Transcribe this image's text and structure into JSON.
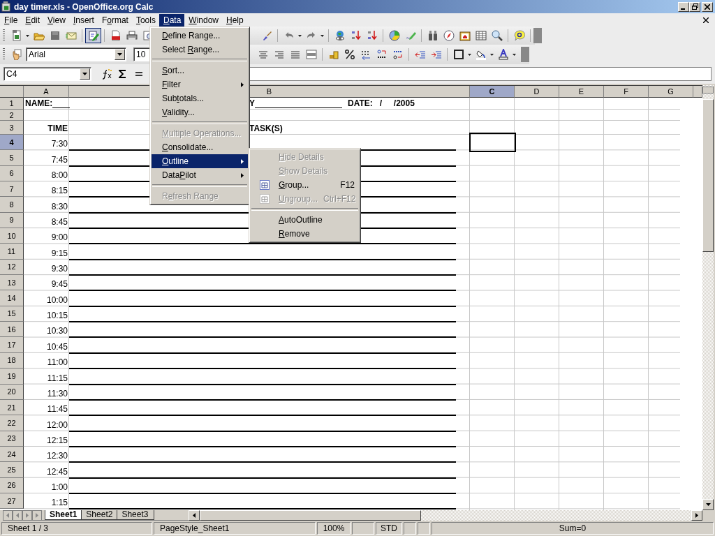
{
  "window": {
    "title": "day timer.xls - OpenOffice.org Calc"
  },
  "menu_bar": [
    {
      "key": "F",
      "post": "ile",
      "selected": false
    },
    {
      "key": "E",
      "post": "dit",
      "selected": false
    },
    {
      "key": "V",
      "post": "iew",
      "selected": false
    },
    {
      "key": "I",
      "post": "nsert",
      "selected": false
    },
    {
      "pre": "F",
      "key": "o",
      "post": "rmat",
      "selected": false
    },
    {
      "key": "T",
      "post": "ools",
      "selected": false
    },
    {
      "key": "D",
      "post": "ata",
      "selected": true
    },
    {
      "key": "W",
      "post": "indow",
      "selected": false
    },
    {
      "key": "H",
      "post": "elp",
      "selected": false
    }
  ],
  "data_menu": [
    {
      "kind": "item",
      "key": "D",
      "post": "efine Range...",
      "disabled": false,
      "selected": false,
      "submenu": false
    },
    {
      "kind": "item",
      "pre": "Select ",
      "key": "R",
      "post": "ange...",
      "disabled": false,
      "selected": false,
      "submenu": false
    },
    {
      "kind": "separator"
    },
    {
      "kind": "item",
      "key": "S",
      "post": "ort...",
      "disabled": false,
      "selected": false,
      "submenu": false
    },
    {
      "kind": "item",
      "key": "F",
      "post": "ilter",
      "disabled": false,
      "selected": false,
      "submenu": true
    },
    {
      "kind": "item",
      "pre": "Sub",
      "key": "t",
      "post": "otals...",
      "disabled": false,
      "selected": false,
      "submenu": false
    },
    {
      "kind": "item",
      "key": "V",
      "post": "alidity...",
      "disabled": false,
      "selected": false,
      "submenu": false
    },
    {
      "kind": "separator"
    },
    {
      "kind": "item",
      "key": "M",
      "post": "ultiple Operations...",
      "disabled": true,
      "selected": false,
      "submenu": false
    },
    {
      "kind": "item",
      "key": "C",
      "post": "onsolidate...",
      "disabled": false,
      "selected": false,
      "submenu": false
    },
    {
      "kind": "item",
      "key": "O",
      "post": "utline",
      "disabled": false,
      "selected": true,
      "submenu": true
    },
    {
      "kind": "item",
      "pre": "Data",
      "key": "P",
      "post": "ilot",
      "disabled": false,
      "selected": false,
      "submenu": true
    },
    {
      "kind": "separator"
    },
    {
      "kind": "item",
      "pre": "R",
      "key": "e",
      "post": "fresh Range",
      "disabled": true,
      "selected": false,
      "submenu": false
    }
  ],
  "outline_submenu": [
    {
      "kind": "item",
      "key": "H",
      "post": "ide Details",
      "disabled": true
    },
    {
      "kind": "item",
      "key": "S",
      "post": "how Details",
      "disabled": true
    },
    {
      "kind": "icon-item",
      "key": "G",
      "post": "roup...",
      "shortcut": "F12",
      "disabled": false
    },
    {
      "kind": "icon-item",
      "key": "U",
      "post": "ngroup...",
      "shortcut": "Ctrl+F12",
      "disabled": true
    },
    {
      "kind": "separator"
    },
    {
      "kind": "item",
      "key": "A",
      "post": "utoOutline",
      "disabled": false
    },
    {
      "kind": "item",
      "key": "R",
      "post": "emove",
      "disabled": false
    }
  ],
  "font": {
    "name": "Arial",
    "size": "10"
  },
  "name_box": "C4",
  "columns": [
    {
      "label": "A",
      "selected": false
    },
    {
      "label": "B",
      "selected": false
    },
    {
      "label": "C",
      "selected": true
    },
    {
      "label": "D",
      "selected": false
    },
    {
      "label": "E",
      "selected": false
    },
    {
      "label": "F",
      "selected": false
    },
    {
      "label": "G",
      "selected": false
    }
  ],
  "rows": [
    {
      "header": "1",
      "selected": false,
      "kind": "name-date",
      "name_label": "NAME:",
      "b_start": "Y",
      "date": "DATE:   /     /2005"
    },
    {
      "header": "2",
      "selected": false,
      "kind": "empty"
    },
    {
      "header": "3",
      "selected": false,
      "kind": "heading",
      "time": "TIME",
      "task": "TASK(S)"
    },
    {
      "header": "4",
      "selected": true,
      "kind": "slot",
      "time": "7:30"
    },
    {
      "header": "5",
      "selected": false,
      "kind": "slot",
      "time": "7:45"
    },
    {
      "header": "6",
      "selected": false,
      "kind": "slot",
      "time": "8:00"
    },
    {
      "header": "7",
      "selected": false,
      "kind": "slot",
      "time": "8:15"
    },
    {
      "header": "8",
      "selected": false,
      "kind": "slot",
      "time": "8:30"
    },
    {
      "header": "9",
      "selected": false,
      "kind": "slot",
      "time": "8:45"
    },
    {
      "header": "10",
      "selected": false,
      "kind": "slot",
      "time": "9:00"
    },
    {
      "header": "11",
      "selected": false,
      "kind": "slot",
      "time": "9:15"
    },
    {
      "header": "12",
      "selected": false,
      "kind": "slot",
      "time": "9:30"
    },
    {
      "header": "13",
      "selected": false,
      "kind": "slot",
      "time": "9:45"
    },
    {
      "header": "14",
      "selected": false,
      "kind": "slot",
      "time": "10:00"
    },
    {
      "header": "15",
      "selected": false,
      "kind": "slot",
      "time": "10:15"
    },
    {
      "header": "16",
      "selected": false,
      "kind": "slot",
      "time": "10:30"
    },
    {
      "header": "17",
      "selected": false,
      "kind": "slot",
      "time": "10:45"
    },
    {
      "header": "18",
      "selected": false,
      "kind": "slot",
      "time": "11:00"
    },
    {
      "header": "19",
      "selected": false,
      "kind": "slot",
      "time": "11:15"
    },
    {
      "header": "20",
      "selected": false,
      "kind": "slot",
      "time": "11:30"
    },
    {
      "header": "21",
      "selected": false,
      "kind": "slot",
      "time": "11:45"
    },
    {
      "header": "22",
      "selected": false,
      "kind": "slot",
      "time": "12:00"
    },
    {
      "header": "23",
      "selected": false,
      "kind": "slot",
      "time": "12:15"
    },
    {
      "header": "24",
      "selected": false,
      "kind": "slot",
      "time": "12:30"
    },
    {
      "header": "25",
      "selected": false,
      "kind": "slot",
      "time": "12:45"
    },
    {
      "header": "26",
      "selected": false,
      "kind": "slot",
      "time": "1:00"
    },
    {
      "header": "27",
      "selected": false,
      "kind": "slot",
      "time": "1:15"
    }
  ],
  "sheet_tabs": [
    {
      "label": "Sheet1",
      "selected": true
    },
    {
      "label": "Sheet2",
      "selected": false
    },
    {
      "label": "Sheet3",
      "selected": false
    }
  ],
  "status_bar": {
    "sheet": "Sheet 1 / 3",
    "page_style": "PageStyle_Sheet1",
    "zoom": "100%",
    "mode": "STD",
    "sum": "Sum=0"
  }
}
